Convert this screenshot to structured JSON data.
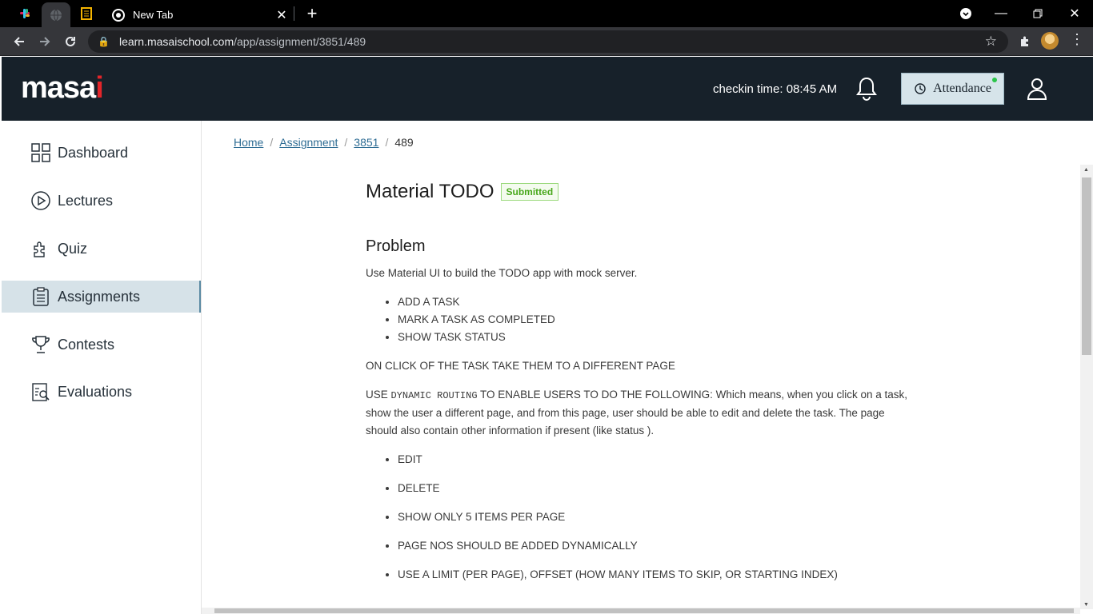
{
  "browser": {
    "active_tab_title": "New Tab",
    "url_domain": "learn.masaischool.com",
    "url_path": "/app/assignment/3851/489"
  },
  "header": {
    "logo_main": "masa",
    "logo_accent": "i",
    "checkin": "checkin time: 08:45 AM",
    "attendance_label": "Attendance"
  },
  "sidebar": {
    "items": [
      {
        "label": "Dashboard",
        "icon": "grid-icon"
      },
      {
        "label": "Lectures",
        "icon": "play-circle-icon"
      },
      {
        "label": "Quiz",
        "icon": "puzzle-icon"
      },
      {
        "label": "Assignments",
        "icon": "clipboard-icon",
        "active": true
      },
      {
        "label": "Contests",
        "icon": "trophy-icon"
      },
      {
        "label": "Evaluations",
        "icon": "evaluation-icon"
      }
    ]
  },
  "breadcrumb": {
    "home": "Home",
    "assignment": "Assignment",
    "id": "3851",
    "current": "489"
  },
  "assignment": {
    "title": "Material TODO",
    "status": "Submitted",
    "section_heading": "Problem",
    "intro": "Use Material UI to build the TODO app with mock server.",
    "features": [
      "ADD A TASK",
      "MARK A TASK AS COMPLETED",
      "SHOW TASK STATUS"
    ],
    "click_note": "ON CLICK OF THE TASK TAKE THEM TO A DIFFERENT PAGE",
    "routing_prefix": "USE ",
    "routing_code": "DYNAMIC ROUTING",
    "routing_suffix": " TO ENABLE USERS TO DO THE FOLLOWING: Which means, when you click on a task, show the user a different page, and from this page, user should be able to edit and delete the task. The page should also contain other information if present (like status ).",
    "requirements": [
      "EDIT",
      "DELETE",
      "SHOW ONLY 5 ITEMS PER PAGE",
      "PAGE NOS SHOULD BE ADDED DYNAMICALLY",
      "USE A LIMIT (PER PAGE), OFFSET (HOW MANY ITEMS TO SKIP, OR STARTING INDEX)"
    ]
  }
}
